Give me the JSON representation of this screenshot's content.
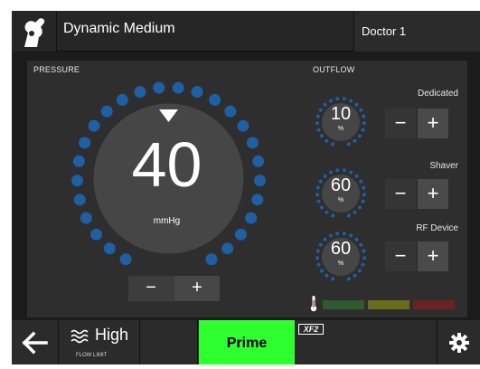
{
  "header": {
    "mode": "Dynamic Medium",
    "user": "Doctor 1"
  },
  "pressure": {
    "label": "PRESSURE",
    "value": "40",
    "unit": "mmHg",
    "minus": "−",
    "plus": "+"
  },
  "outflow": {
    "label": "OUTFLOW",
    "items": [
      {
        "name": "Dedicated",
        "value": "10",
        "unit": "%",
        "minus": "−",
        "plus": "+"
      },
      {
        "name": "Shaver",
        "value": "60",
        "unit": "%",
        "minus": "−",
        "plus": "+"
      },
      {
        "name": "RF Device",
        "value": "60",
        "unit": "%",
        "minus": "−",
        "plus": "+"
      }
    ],
    "temperature_levels": [
      "#2f5a2f",
      "#6b6b1e",
      "#6b2222"
    ]
  },
  "footer": {
    "flow": "High",
    "flow_caption": "FLOW LIMIT",
    "prime": "Prime",
    "badge": "XF2"
  },
  "colors": {
    "accent_dot": "#1f5fa3",
    "prime_green": "#2eff2e"
  }
}
